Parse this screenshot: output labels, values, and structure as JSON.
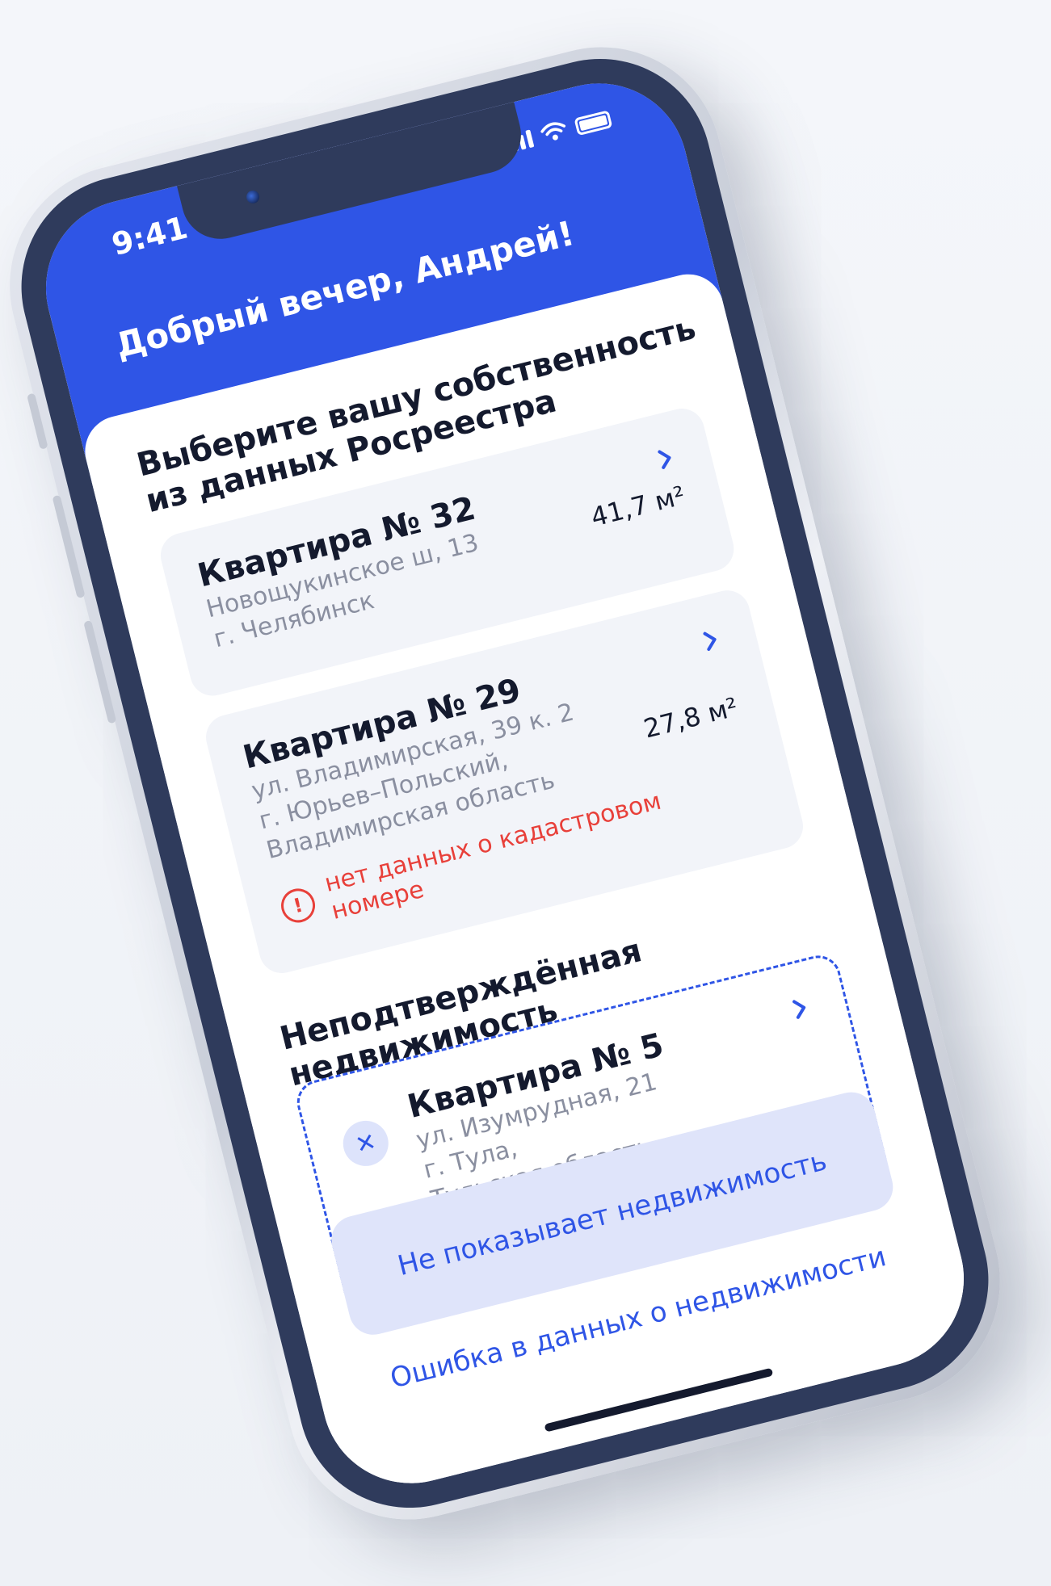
{
  "status_bar": {
    "time": "9:41"
  },
  "header": {
    "greeting": "Добрый вечер, Андрей!"
  },
  "registry_section": {
    "title_line1": "Выберите вашу собственность",
    "title_line2": "из данных Росреестра",
    "properties": [
      {
        "title": "Квартира № 32",
        "address_line1": "Новощукинское ш, 13",
        "address_line2": "г. Челябинск",
        "area": "41,7 м²"
      },
      {
        "title": "Квартира № 29",
        "address_line1": "ул. Владимирская, 39 к. 2",
        "address_line2": "г. Юрьев–Польский,",
        "address_line3": "Владимирская область",
        "area": "27,8 м²",
        "warning": "нет данных о кадастровом номере"
      }
    ]
  },
  "unconfirmed_section": {
    "title": "Неподтверждённая недвижимость",
    "properties": [
      {
        "title": "Квартира № 5",
        "address_line1": "ул. Изумрудная, 21",
        "address_line2": "г. Тула,",
        "address_line3": "Тульская область"
      }
    ]
  },
  "actions": {
    "primary_label": "Не показывает недвижимость",
    "secondary_label": "Ошибка в данных о недвижимости"
  },
  "colors": {
    "accent": "#2f55e6",
    "warning": "#e8403a",
    "bezel": "#2f3b5c"
  },
  "icons": {
    "chevron": "chevron-right-icon",
    "warning": "exclamation-circle-icon",
    "remove": "close-icon",
    "wifi": "wifi-icon",
    "signal": "signal-icon",
    "battery": "battery-icon"
  }
}
